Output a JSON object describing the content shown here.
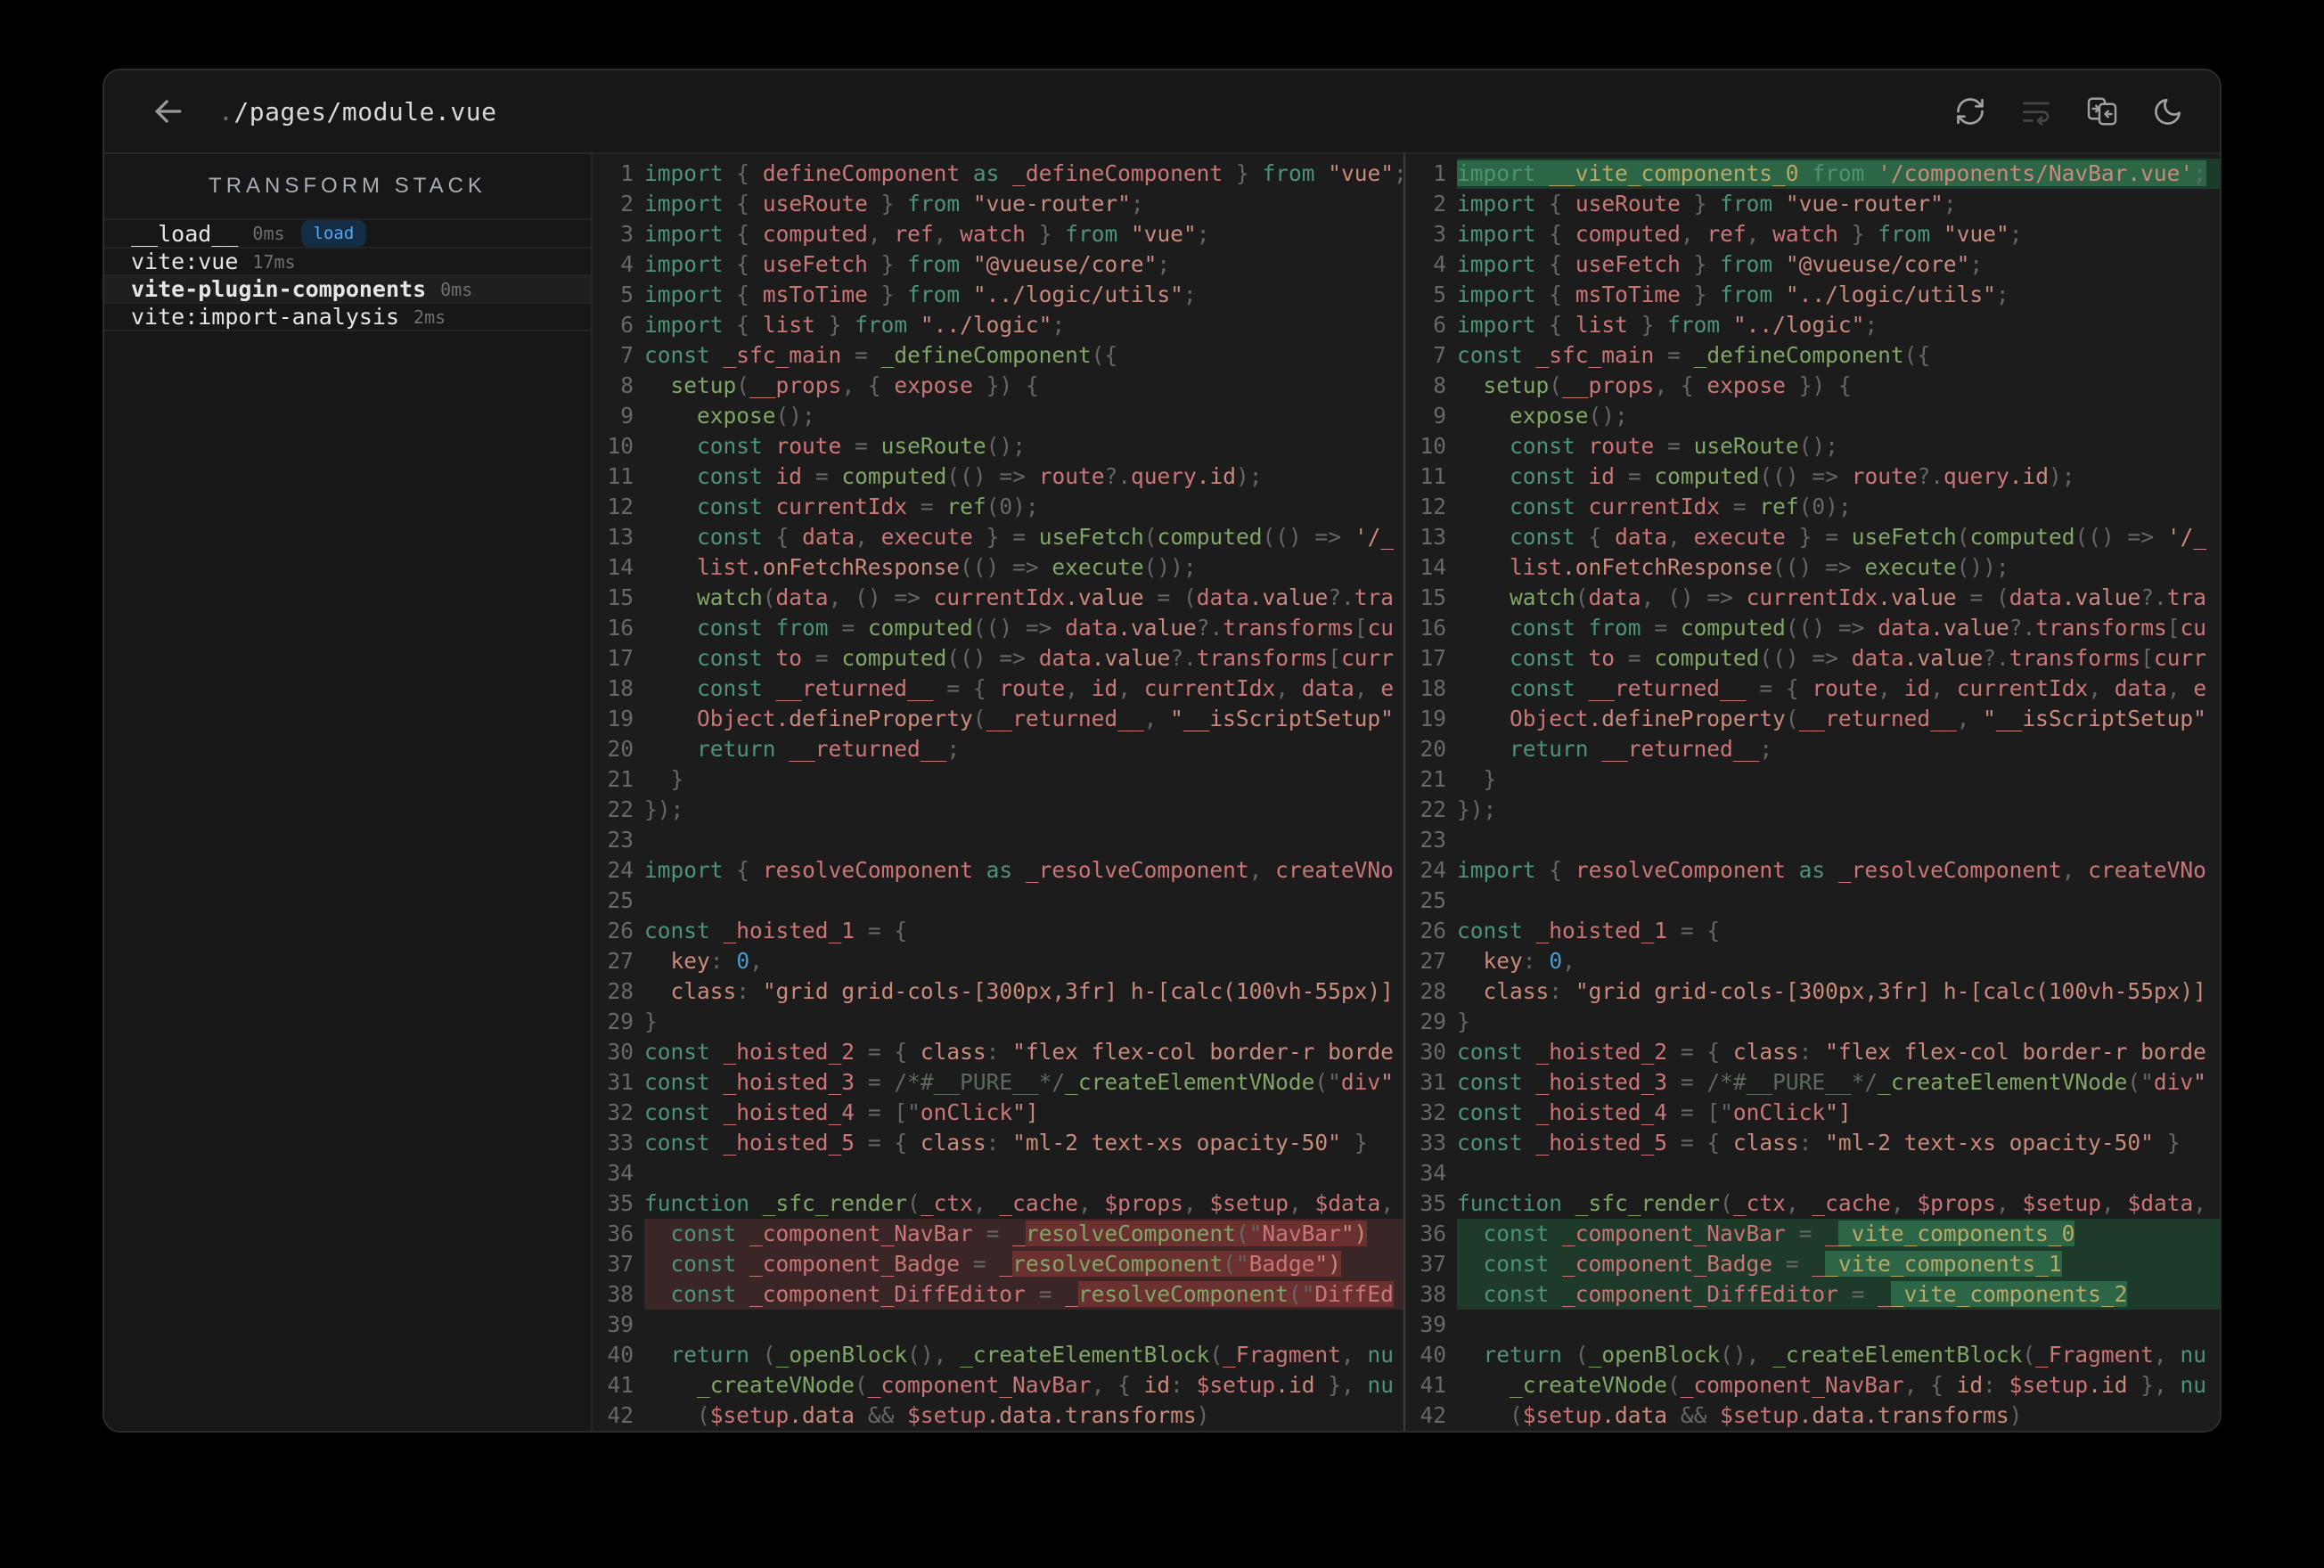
{
  "header": {
    "title_prefix": ".",
    "title": "/pages/module.vue",
    "buttons": [
      "back-button",
      "refresh-button",
      "word-wrap-button",
      "side-by-side-diff-button",
      "dark-mode-button"
    ]
  },
  "sidebar": {
    "header_label": "TRANSFORM STACK",
    "items": [
      {
        "name": "__load__",
        "time": "0ms",
        "badge": "load",
        "selected": false
      },
      {
        "name": "vite:vue",
        "time": "17ms",
        "badge": null,
        "selected": false
      },
      {
        "name": "vite-plugin-components",
        "time": "0ms",
        "badge": null,
        "selected": true
      },
      {
        "name": "vite:import-analysis",
        "time": "2ms",
        "badge": null,
        "selected": false
      }
    ],
    "badge_colors": {
      "bg": "#142c44",
      "text": "#55a7f0"
    }
  },
  "diff": {
    "colors": {
      "removed_line_bg": "#3a2627",
      "removed_word_bg": "#6b3130",
      "added_line_bg": "#1d3a2b",
      "added_word_bg": "#2c6647"
    },
    "syntax_colors": {
      "keyword": "#4d9375",
      "string": "#c98a7d",
      "number": "#4c9bcf",
      "call": "#80a665",
      "key": "#c98a7d",
      "property": "#c98a7d",
      "identifier": "#cb7676",
      "punctuation": "#666666",
      "comment": "#5d6a5d",
      "vite_component": "#b8a965",
      "default": "#dbd7ca"
    },
    "left": {
      "lines": [
        {
          "t": "import { defineComponent as _defineComponent } from \"vue\";"
        },
        {
          "t": "import { useRoute } from \"vue-router\";"
        },
        {
          "t": "import { computed, ref, watch } from \"vue\";"
        },
        {
          "t": "import { useFetch } from \"@vueuse/core\";"
        },
        {
          "t": "import { msToTime } from \"../logic/utils\";"
        },
        {
          "t": "import { list } from \"../logic\";"
        },
        {
          "t": "const _sfc_main = _defineComponent({"
        },
        {
          "t": "  setup(__props, { expose }) {"
        },
        {
          "t": "    expose();"
        },
        {
          "t": "    const route = useRoute();"
        },
        {
          "t": "    const id = computed(() => route?.query.id);"
        },
        {
          "t": "    const currentIdx = ref(0);"
        },
        {
          "t": "    const { data, execute } = useFetch(computed(() => '/_"
        },
        {
          "t": "    list.onFetchResponse(() => execute());"
        },
        {
          "t": "    watch(data, () => currentIdx.value = (data.value?.tra"
        },
        {
          "t": "    const from = computed(() => data.value?.transforms[cu"
        },
        {
          "t": "    const to = computed(() => data.value?.transforms[curr"
        },
        {
          "t": "    const __returned__ = { route, id, currentIdx, data, e"
        },
        {
          "t": "    Object.defineProperty(__returned__, \"__isScriptSetup\""
        },
        {
          "t": "    return __returned__;"
        },
        {
          "t": "  }"
        },
        {
          "t": "});"
        },
        {
          "t": ""
        },
        {
          "t": "import { resolveComponent as _resolveComponent, createVNo"
        },
        {
          "t": ""
        },
        {
          "t": "const _hoisted_1 = {"
        },
        {
          "t": "  key: 0,"
        },
        {
          "t": "  class: \"grid grid-cols-[300px,3fr] h-[calc(100vh-55px)]"
        },
        {
          "t": "}"
        },
        {
          "t": "const _hoisted_2 = { class: \"flex flex-col border-r borde"
        },
        {
          "t": "const _hoisted_3 = /*#__PURE__*/_createElementVNode(\"div\""
        },
        {
          "t": "const _hoisted_4 = [\"onClick\"]"
        },
        {
          "t": "const _hoisted_5 = { class: \"ml-2 text-xs opacity-50\" }"
        },
        {
          "t": ""
        },
        {
          "t": "function _sfc_render(_ctx, _cache, $props, $setup, $data,"
        },
        {
          "t": "  const _component_NavBar = _resolveComponent(\"NavBar\")",
          "d": "del",
          "h": "resolveComponent(\"NavBar\")"
        },
        {
          "t": "  const _component_Badge = _resolveComponent(\"Badge\")",
          "d": "del",
          "h": "resolveComponent(\"Badge\")"
        },
        {
          "t": "  const _component_DiffEditor = _resolveComponent(\"DiffEd",
          "d": "del",
          "h": "resolveComponent(\"DiffEd"
        },
        {
          "t": ""
        },
        {
          "t": "  return (_openBlock(), _createElementBlock(_Fragment, nu"
        },
        {
          "t": "    _createVNode(_component_NavBar, { id: $setup.id }, nu"
        },
        {
          "t": "    ($setup.data && $setup.data.transforms)"
        }
      ]
    },
    "right": {
      "lines": [
        {
          "t": "import __vite_components_0 from '/components/NavBar.vue';",
          "d": "add",
          "h": "import __vite_components_0 from '/components/NavBar.vue';"
        },
        {
          "t": "import { useRoute } from \"vue-router\";"
        },
        {
          "t": "import { computed, ref, watch } from \"vue\";"
        },
        {
          "t": "import { useFetch } from \"@vueuse/core\";"
        },
        {
          "t": "import { msToTime } from \"../logic/utils\";"
        },
        {
          "t": "import { list } from \"../logic\";"
        },
        {
          "t": "const _sfc_main = _defineComponent({"
        },
        {
          "t": "  setup(__props, { expose }) {"
        },
        {
          "t": "    expose();"
        },
        {
          "t": "    const route = useRoute();"
        },
        {
          "t": "    const id = computed(() => route?.query.id);"
        },
        {
          "t": "    const currentIdx = ref(0);"
        },
        {
          "t": "    const { data, execute } = useFetch(computed(() => '/_"
        },
        {
          "t": "    list.onFetchResponse(() => execute());"
        },
        {
          "t": "    watch(data, () => currentIdx.value = (data.value?.tra"
        },
        {
          "t": "    const from = computed(() => data.value?.transforms[cu"
        },
        {
          "t": "    const to = computed(() => data.value?.transforms[curr"
        },
        {
          "t": "    const __returned__ = { route, id, currentIdx, data, e"
        },
        {
          "t": "    Object.defineProperty(__returned__, \"__isScriptSetup\""
        },
        {
          "t": "    return __returned__;"
        },
        {
          "t": "  }"
        },
        {
          "t": "});"
        },
        {
          "t": ""
        },
        {
          "t": "import { resolveComponent as _resolveComponent, createVNo"
        },
        {
          "t": ""
        },
        {
          "t": "const _hoisted_1 = {"
        },
        {
          "t": "  key: 0,"
        },
        {
          "t": "  class: \"grid grid-cols-[300px,3fr] h-[calc(100vh-55px)]"
        },
        {
          "t": "}"
        },
        {
          "t": "const _hoisted_2 = { class: \"flex flex-col border-r borde"
        },
        {
          "t": "const _hoisted_3 = /*#__PURE__*/_createElementVNode(\"div\""
        },
        {
          "t": "const _hoisted_4 = [\"onClick\"]"
        },
        {
          "t": "const _hoisted_5 = { class: \"ml-2 text-xs opacity-50\" }"
        },
        {
          "t": ""
        },
        {
          "t": "function _sfc_render(_ctx, _cache, $props, $setup, $data,"
        },
        {
          "t": "  const _component_NavBar = __vite_components_0",
          "d": "add",
          "h": "_vite_components_0"
        },
        {
          "t": "  const _component_Badge = __vite_components_1",
          "d": "add",
          "h": "_vite_components_1"
        },
        {
          "t": "  const _component_DiffEditor = __vite_components_2",
          "d": "add",
          "h": "_vite_components_2"
        },
        {
          "t": ""
        },
        {
          "t": "  return (_openBlock(), _createElementBlock(_Fragment, nu"
        },
        {
          "t": "    _createVNode(_component_NavBar, { id: $setup.id }, nu"
        },
        {
          "t": "    ($setup.data && $setup.data.transforms)"
        }
      ]
    }
  }
}
